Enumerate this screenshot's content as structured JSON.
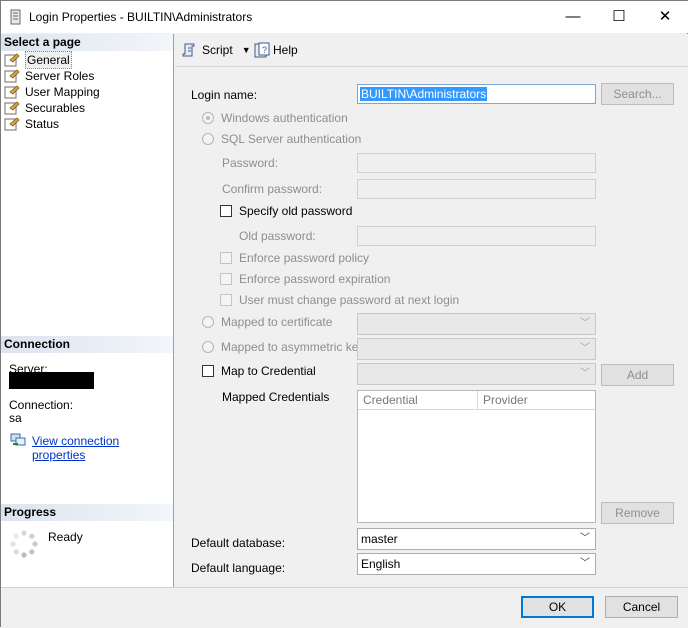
{
  "window": {
    "title": "Login Properties - BUILTIN\\Administrators",
    "minimize_glyph": "—",
    "maximize_glyph": "☐",
    "close_glyph": "✕"
  },
  "left": {
    "select_page_header": "Select a page",
    "pages": [
      {
        "label": "General",
        "selected": true,
        "icon": "wrench-page-icon"
      },
      {
        "label": "Server Roles",
        "selected": false,
        "icon": "wrench-page-icon"
      },
      {
        "label": "User Mapping",
        "selected": false,
        "icon": "wrench-page-icon"
      },
      {
        "label": "Securables",
        "selected": false,
        "icon": "wrench-page-icon"
      },
      {
        "label": "Status",
        "selected": false,
        "icon": "wrench-page-icon"
      }
    ],
    "connection_header": "Connection",
    "server_label": "Server:",
    "connection_label": "Connection:",
    "connection_value": "sa",
    "view_connection_link": "View connection properties",
    "progress_header": "Progress",
    "progress_status": "Ready"
  },
  "toolbar": {
    "script_label": "Script",
    "help_label": "Help"
  },
  "form": {
    "login_name_label": "Login name:",
    "login_name_value": "BUILTIN\\Administrators",
    "search_button": "Search...",
    "windows_auth": "Windows authentication",
    "sql_auth": "SQL Server authentication",
    "password_label": "Password:",
    "confirm_password_label": "Confirm password:",
    "specify_old_password": "Specify old password",
    "old_password_label": "Old password:",
    "enforce_policy": "Enforce password policy",
    "enforce_expiration": "Enforce password expiration",
    "must_change": "User must change password at next login",
    "mapped_to_certificate": "Mapped to certificate",
    "mapped_to_asym_key": "Mapped to asymmetric key",
    "map_to_credential": "Map to Credential",
    "add_button": "Add",
    "mapped_credentials_label": "Mapped Credentials",
    "grid_columns": [
      "Credential",
      "Provider"
    ],
    "remove_button": "Remove",
    "default_database_label": "Default database:",
    "default_database_value": "master",
    "default_language_label": "Default language:",
    "default_language_value": "English"
  },
  "footer": {
    "ok_button": "OK",
    "cancel_button": "Cancel"
  },
  "colors": {
    "accent": "#0078d7",
    "link": "#0033cc",
    "selection": "#3399ff"
  }
}
